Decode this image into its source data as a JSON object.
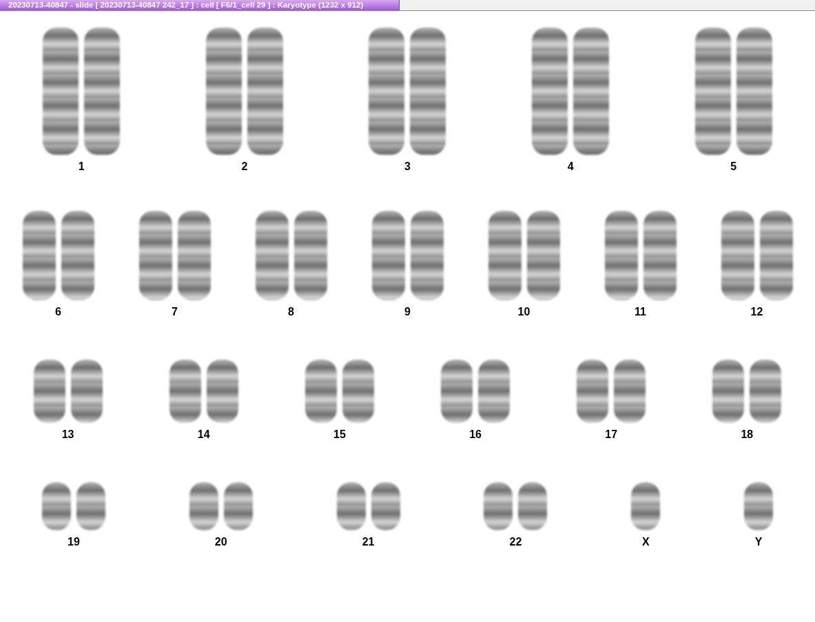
{
  "window": {
    "title": "20230713-40847 - slide [ 20230713-40847 242_17 ] : cell [ F6/1_cell 29 ] : Karyotype  (1232 x 912)"
  },
  "rows": [
    {
      "groups": [
        {
          "label": "1",
          "kind": "pair"
        },
        {
          "label": "2",
          "kind": "pair"
        },
        {
          "label": "3",
          "kind": "pair"
        },
        {
          "label": "4",
          "kind": "pair"
        },
        {
          "label": "5",
          "kind": "pair"
        }
      ]
    },
    {
      "groups": [
        {
          "label": "6",
          "kind": "pair"
        },
        {
          "label": "7",
          "kind": "pair"
        },
        {
          "label": "8",
          "kind": "pair"
        },
        {
          "label": "9",
          "kind": "pair"
        },
        {
          "label": "10",
          "kind": "pair"
        },
        {
          "label": "11",
          "kind": "pair"
        },
        {
          "label": "12",
          "kind": "pair"
        }
      ]
    },
    {
      "groups": [
        {
          "label": "13",
          "kind": "pair"
        },
        {
          "label": "14",
          "kind": "pair"
        },
        {
          "label": "15",
          "kind": "pair"
        },
        {
          "label": "16",
          "kind": "pair"
        },
        {
          "label": "17",
          "kind": "pair"
        },
        {
          "label": "18",
          "kind": "pair"
        }
      ]
    },
    {
      "groups": [
        {
          "label": "19",
          "kind": "pair"
        },
        {
          "label": "20",
          "kind": "pair"
        },
        {
          "label": "21",
          "kind": "pair"
        },
        {
          "label": "22",
          "kind": "pair"
        },
        {
          "label": "X",
          "kind": "single"
        },
        {
          "label": "Y",
          "kind": "single"
        }
      ]
    }
  ]
}
